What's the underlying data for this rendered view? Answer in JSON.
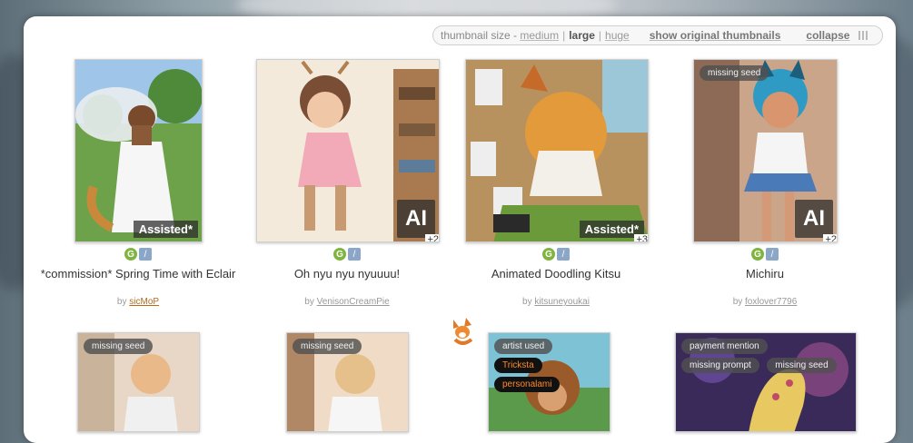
{
  "toolbar": {
    "size_label": "thumbnail size -",
    "size_medium": "medium",
    "size_large": "large",
    "size_huge": "huge",
    "sep": "|",
    "show_original": "show original thumbnails",
    "collapse": "collapse"
  },
  "row1": [
    {
      "title": "*commission* Spring Time with Eclair",
      "by": "by",
      "author": "sicMoP",
      "badge": "Assisted*",
      "count": "",
      "tags": []
    },
    {
      "title": "Oh nyu nyu nyuuuu!",
      "by": "by",
      "author": "VenisonCreamPie",
      "badge": "AI",
      "count": "+2",
      "tags": []
    },
    {
      "title": "Animated Doodling Kitsu",
      "by": "by",
      "author": "kitsuneyoukai",
      "badge": "Assisted*",
      "count": "+3",
      "tags": []
    },
    {
      "title": "Michiru",
      "by": "by",
      "author": "foxlover7796",
      "badge": "AI",
      "count": "+2",
      "tags": [
        "missing seed"
      ]
    }
  ],
  "row2": [
    {
      "tags": [
        "missing seed"
      ]
    },
    {
      "tags": [
        "missing seed"
      ]
    },
    {
      "tags": [
        "artist used",
        "Tricksta",
        "personalami"
      ]
    },
    {
      "tags": [
        "payment mention",
        "missing prompt",
        "missing seed"
      ]
    }
  ],
  "icons": {
    "g": "G",
    "b": "/"
  },
  "colors": {
    "accent_author": "#b56a1e",
    "tag_bg": "#505050",
    "tag_orange": "#ff8a2b",
    "g_icon": "#7fb53f",
    "b_icon": "#8aa6c8"
  }
}
